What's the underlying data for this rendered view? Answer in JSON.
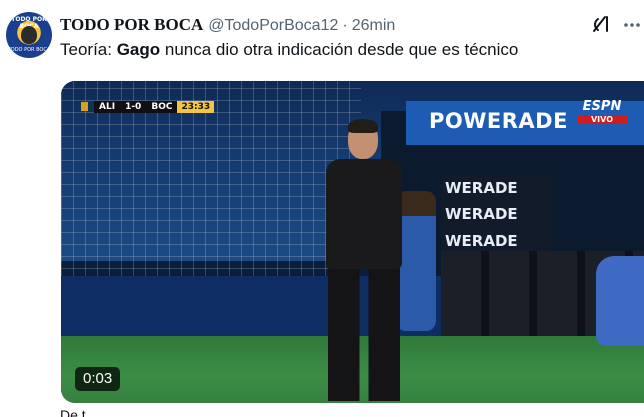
{
  "post": {
    "author_name": "TODO POR BOCA",
    "handle": "@TodoPorBoca12",
    "separator": "·",
    "time": "26min",
    "text_prefix": "Teoría: ",
    "text_bold": "Gago",
    "text_suffix": " nunca dio otra indicación desde que es técnico",
    "footer_text": "De t"
  },
  "avatar": {
    "top_text": "TODO POR BOCA",
    "bottom_text": "TODO POR BOCA"
  },
  "video": {
    "duration": "0:03",
    "scoreboard": {
      "home": "ALI",
      "score": "1-0",
      "away": "BOC",
      "clock": "23:33"
    },
    "broadcaster": "ESPN",
    "live_label": "VIVO",
    "sponsor_top": "POWERADE",
    "sponsor_side": [
      "WERADE",
      "WERADE",
      "WERADE"
    ]
  },
  "icons": {
    "grok": "grok-icon",
    "more": "more-icon"
  }
}
